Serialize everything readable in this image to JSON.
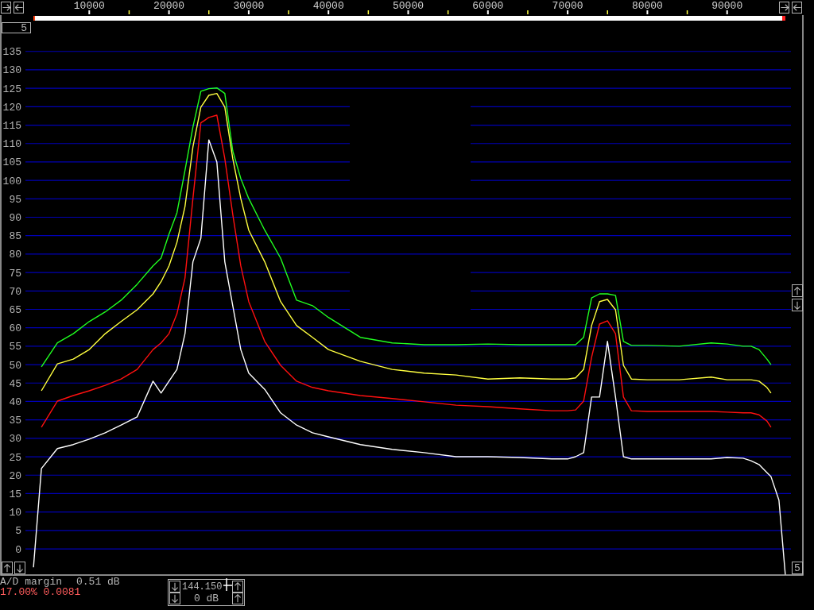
{
  "spectrum": {
    "chart_data": {
      "type": "line",
      "grid": true,
      "x": [
        3000,
        4000,
        6000,
        8000,
        10000,
        12000,
        14000,
        16000,
        18000,
        19000,
        20000,
        21000,
        22000,
        23000,
        24000,
        25000,
        26000,
        27000,
        28000,
        29000,
        30000,
        32000,
        34000,
        36000,
        38000,
        40000,
        44000,
        48000,
        52000,
        56000,
        60000,
        64000,
        68000,
        70000,
        71000,
        72000,
        73000,
        74000,
        75000,
        76000,
        77000,
        78000,
        80000,
        84000,
        88000,
        90000,
        92000,
        93000,
        94000,
        95000,
        95500,
        96500,
        97300
      ],
      "series": [
        {
          "color": "#20ff20",
          "values": [
            null,
            49.4,
            55.9,
            58.4,
            61.7,
            64.3,
            67.5,
            71.8,
            76.8,
            78.9,
            85.4,
            91.2,
            102.7,
            114.5,
            124.2,
            124.9,
            125.1,
            123.6,
            108,
            100.5,
            95.1,
            86.5,
            78.9,
            67.5,
            66,
            62.8,
            57.4,
            55.9,
            55.4,
            55.4,
            55.6,
            55.4,
            55.4,
            55.4,
            55.4,
            57.4,
            68.1,
            69.2,
            69.2,
            68.8,
            56.3,
            55.2,
            55.2,
            55,
            55.9,
            55.6,
            55,
            55,
            54.1,
            51.5,
            50,
            null,
            null
          ]
        },
        {
          "color": "#ffff40",
          "values": [
            null,
            42.9,
            50.2,
            51.5,
            54.1,
            58.4,
            61.7,
            64.9,
            69.2,
            72.5,
            76.8,
            83.2,
            92.9,
            109.1,
            119.9,
            123.1,
            123.6,
            119.9,
            105.9,
            95.1,
            86.5,
            77.9,
            67.1,
            60.6,
            57.4,
            54.1,
            50.9,
            48.7,
            47.7,
            47.2,
            46.1,
            46.4,
            46.1,
            46.1,
            46.4,
            48.7,
            60.6,
            67.1,
            67.7,
            64.9,
            49.8,
            46.1,
            45.9,
            45.9,
            46.6,
            45.9,
            45.9,
            45.9,
            45.5,
            43.8,
            42.3,
            null,
            null
          ]
        },
        {
          "color": "#ff1010",
          "values": [
            null,
            33,
            40.1,
            41.6,
            42.9,
            44.4,
            46.1,
            48.7,
            54.1,
            55.9,
            58.4,
            63.8,
            73.5,
            95.1,
            115.6,
            117.1,
            117.7,
            105.9,
            90.8,
            76.8,
            67.1,
            56.3,
            49.8,
            45.5,
            43.8,
            42.9,
            41.6,
            40.8,
            39.9,
            39,
            38.6,
            38,
            37.5,
            37.5,
            37.7,
            40.1,
            52,
            61,
            61.9,
            58.4,
            41.2,
            37.5,
            37.3,
            37.3,
            37.3,
            37.1,
            36.9,
            36.9,
            36.4,
            34.7,
            33,
            null,
            null
          ]
        },
        {
          "color": "#ffffff",
          "values": [
            -5,
            21.8,
            27.2,
            28.3,
            29.8,
            31.5,
            33.6,
            35.8,
            45.5,
            42.3,
            45.5,
            48.7,
            58.4,
            77.9,
            84.3,
            111,
            105,
            77.9,
            66,
            54.1,
            47.7,
            43.3,
            36.9,
            33.6,
            31.5,
            30.4,
            28.3,
            27,
            26.1,
            25,
            25,
            24.8,
            24.4,
            24.4,
            25,
            26.1,
            41.2,
            41.2,
            56.3,
            41.2,
            25,
            24.4,
            24.4,
            24.4,
            24.4,
            24.8,
            24.6,
            23.9,
            22.9,
            20.7,
            19.6,
            13.2,
            -7
          ]
        }
      ],
      "xlim": [
        -1196,
        99502
      ],
      "ylim": [
        -7,
        144
      ],
      "xticks": [
        10000,
        20000,
        30000,
        40000,
        50000,
        60000,
        70000,
        80000,
        90000
      ],
      "yticks": [
        0,
        5,
        10,
        15,
        20,
        25,
        30,
        35,
        40,
        45,
        50,
        55,
        60,
        65,
        70,
        75,
        80,
        85,
        90,
        95,
        100,
        105,
        110,
        115,
        120,
        125,
        130,
        135
      ]
    }
  },
  "top_step_box": {
    "value": "5"
  },
  "right_step_box": {
    "value": "5"
  },
  "status": {
    "ad_margin_label": "A/D margin",
    "ad_margin_value": "0.51 dB",
    "readout": "17.00% 0.0081"
  },
  "control_panel": {
    "frequency": "144.150",
    "gain": "0 dB"
  }
}
